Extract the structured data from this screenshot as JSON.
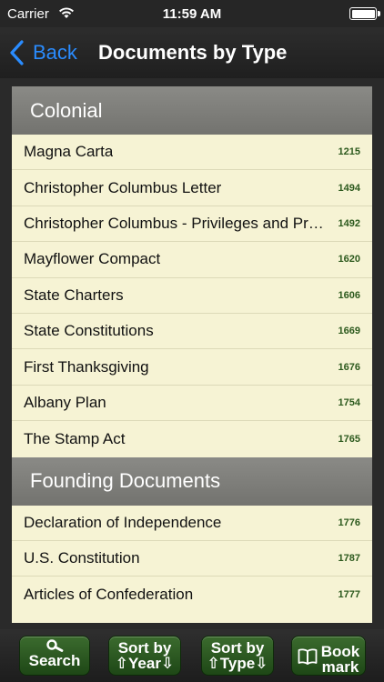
{
  "status_bar": {
    "carrier": "Carrier",
    "time": "11:59 AM"
  },
  "nav": {
    "back_label": "Back",
    "title": "Documents by Type"
  },
  "sections": [
    {
      "header": "Colonial",
      "rows": [
        {
          "title": "Magna Carta",
          "year": "1215"
        },
        {
          "title": "Christopher Columbus Letter",
          "year": "1494"
        },
        {
          "title": "Christopher Columbus - Privileges and Prerogatives",
          "year": "1492"
        },
        {
          "title": "Mayflower Compact",
          "year": "1620"
        },
        {
          "title": "State Charters",
          "year": "1606"
        },
        {
          "title": "State Constitutions",
          "year": "1669"
        },
        {
          "title": "First Thanksgiving",
          "year": "1676"
        },
        {
          "title": "Albany Plan",
          "year": "1754"
        },
        {
          "title": "The Stamp Act",
          "year": "1765"
        }
      ]
    },
    {
      "header": "Founding Documents",
      "rows": [
        {
          "title": "Declaration of Independence",
          "year": "1776"
        },
        {
          "title": "U.S. Constitution",
          "year": "1787"
        },
        {
          "title": "Articles of Confederation",
          "year": "1777"
        }
      ]
    }
  ],
  "toolbar": {
    "search_label": "Search",
    "sort_year_line1": "Sort by",
    "sort_year_line2": "⇧Year⇩",
    "sort_type_line1": "Sort by",
    "sort_type_line2": "⇧Type⇩",
    "bookmark_line1": "Book",
    "bookmark_line2": "mark"
  },
  "colors": {
    "accent": "#2a8cff",
    "list_background": "#f6f3d4",
    "year_text": "#2d5a1e",
    "toolbar_button": "#2f5a24"
  }
}
